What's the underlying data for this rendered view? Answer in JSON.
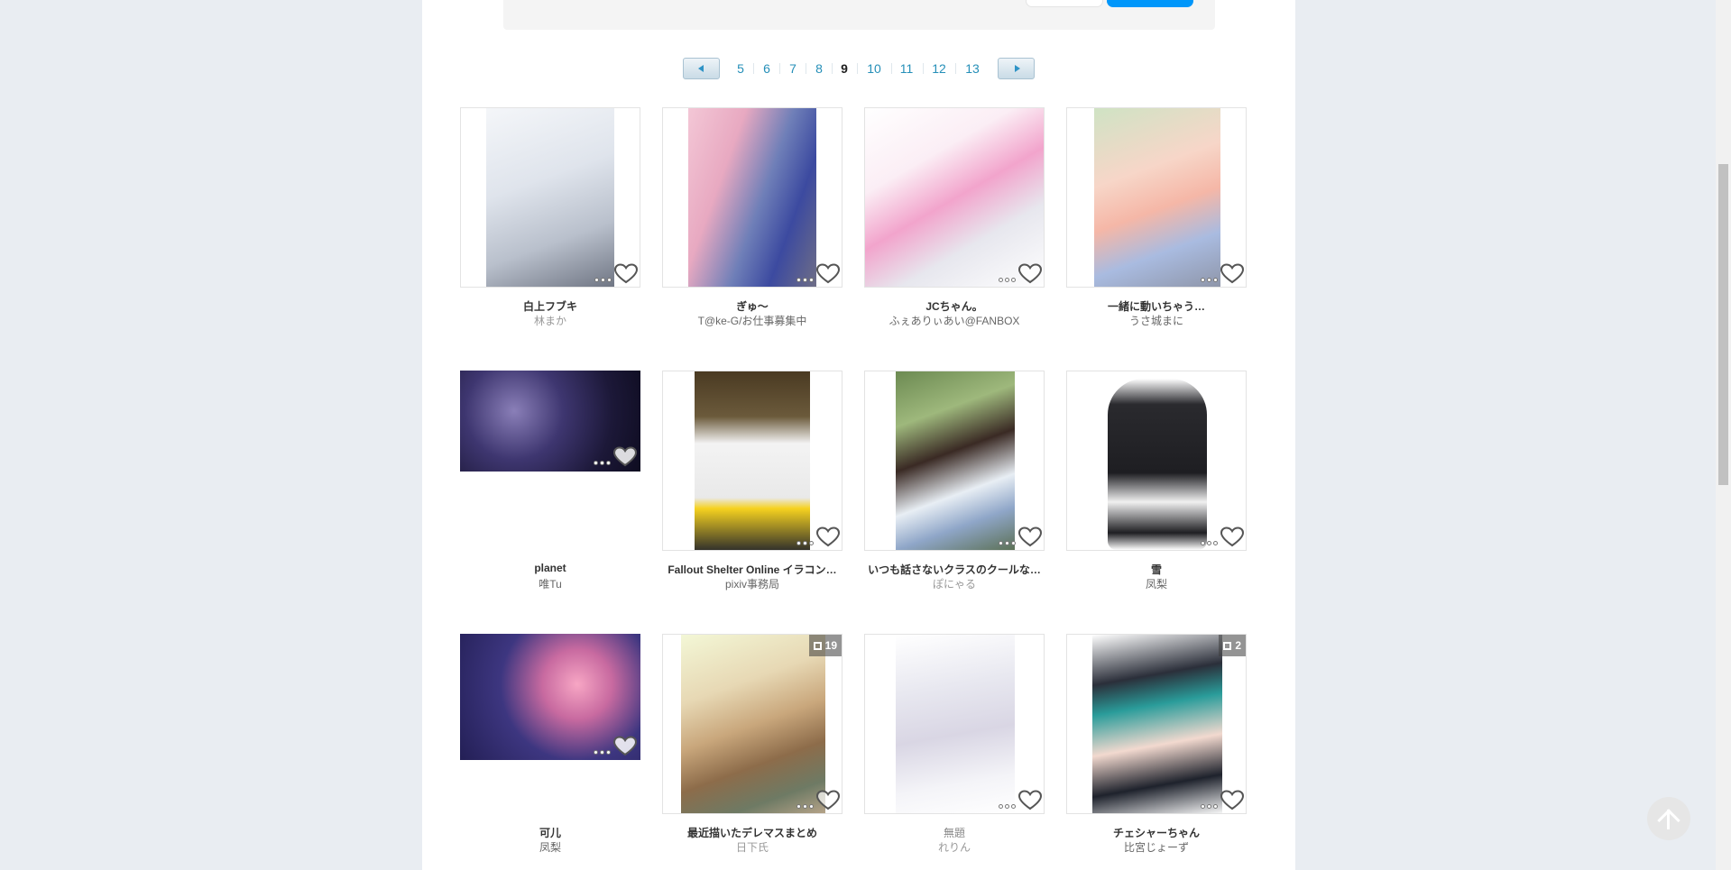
{
  "search": {
    "button_label": ""
  },
  "pager": {
    "pages": [
      "5",
      "6",
      "7",
      "8",
      "9",
      "10",
      "11",
      "12",
      "13"
    ],
    "current": "9"
  },
  "works": [
    {
      "title": "白上フブキ",
      "author": "林まか",
      "badge": ""
    },
    {
      "title": "ぎゅ～",
      "author": "T@ke-G/お仕事募集中",
      "badge": ""
    },
    {
      "title": "JCちゃん。",
      "author": "ふぇありぃあい@FANBOX",
      "badge": ""
    },
    {
      "title": "一緒に動いちゃう…",
      "author": "うさ城まに",
      "badge": ""
    },
    {
      "title": "planet",
      "author": "唯Tu",
      "badge": ""
    },
    {
      "title": "Fallout Shelter Online イラコン…",
      "author": "pixiv事務局",
      "badge": ""
    },
    {
      "title": "いつも話さないクラスのクールな…",
      "author": "ぽにゃる",
      "badge": ""
    },
    {
      "title": "雪",
      "author": "凤梨",
      "badge": ""
    },
    {
      "title": "可儿",
      "author": "凤梨",
      "badge": ""
    },
    {
      "title": "最近描いたデレマスまとめ",
      "author": "日下氏",
      "badge": "19"
    },
    {
      "title": "無題",
      "author": "れりん",
      "badge": ""
    },
    {
      "title": "チェシャーちゃん",
      "author": "比宮じょーず",
      "badge": "2"
    }
  ],
  "colors": {
    "accent": "#0096fa",
    "link": "#258fb8"
  },
  "icons": {
    "like": "heart-icon",
    "more": "more-dots-icon",
    "multi": "multi-page-icon",
    "top": "arrow-up-icon"
  }
}
